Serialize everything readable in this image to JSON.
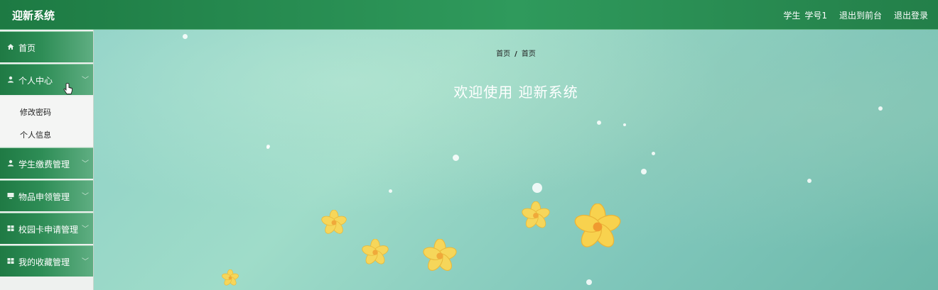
{
  "app": {
    "title": "迎新系统"
  },
  "topnav": {
    "role": "学生",
    "username": "学号1",
    "to_front": "退出到前台",
    "logout": "退出登录"
  },
  "sidebar": {
    "items": [
      {
        "label": "首页",
        "icon": "home-icon"
      },
      {
        "label": "个人中心",
        "icon": "user-icon",
        "expanded": true,
        "children": [
          {
            "label": "修改密码"
          },
          {
            "label": "个人信息"
          }
        ]
      },
      {
        "label": "学生缴费管理",
        "icon": "user-icon"
      },
      {
        "label": "物品申领管理",
        "icon": "monitor-icon"
      },
      {
        "label": "校园卡申请管理",
        "icon": "grid-icon"
      },
      {
        "label": "我的收藏管理",
        "icon": "grid-icon"
      }
    ],
    "chevron": "﹀"
  },
  "main": {
    "breadcrumb": {
      "first": "首页",
      "separator": "/",
      "second": "首页"
    },
    "welcome": "欢迎使用 迎新系统"
  },
  "colors": {
    "brand": "#1d7a43",
    "accent": "#2f9a5c",
    "banner": "#8fd1c7"
  }
}
